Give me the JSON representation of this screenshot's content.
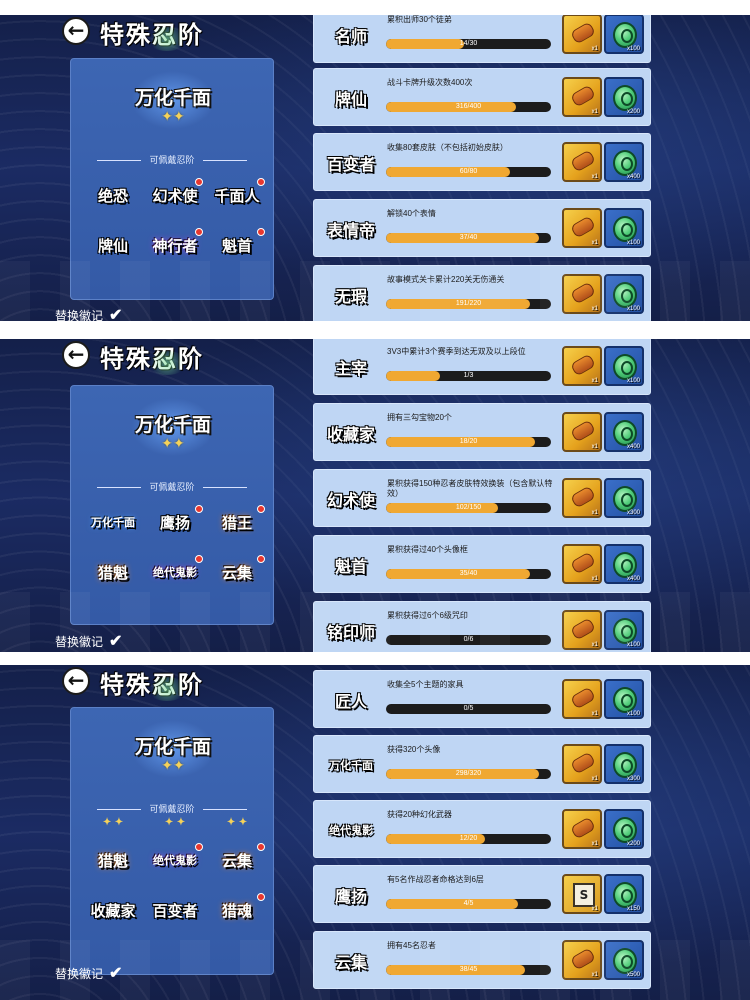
{
  "header": {
    "back_icon": "back-arrow-icon",
    "title": "特殊忍阶"
  },
  "current_title": {
    "text": "万化千面",
    "stars": "✦✦"
  },
  "section_label": "可佩戴忍阶",
  "replace_badge_label": "替换徽记",
  "replace_badge_checked": true,
  "reward_icons": {
    "scroll": "scroll-icon",
    "token": "green-token-icon",
    "card": "card-pack-icon"
  },
  "colors": {
    "panel": "#3d66b3",
    "row": "#bfd6f4",
    "progress_fill": "#f0a832",
    "progress_track": "#1c1c1c",
    "red_dot": "#e8382f"
  },
  "screens": [
    {
      "badges": [
        {
          "label": "绝恐",
          "dot": false,
          "tint": ""
        },
        {
          "label": "幻术使",
          "dot": true,
          "tint": ""
        },
        {
          "label": "千面人",
          "dot": true,
          "tint": ""
        },
        {
          "label": "牌仙",
          "dot": false,
          "tint": ""
        },
        {
          "label": "神行者",
          "dot": true,
          "tint": "purple"
        },
        {
          "label": "魁首",
          "dot": true,
          "tint": ""
        }
      ],
      "tasks": [
        {
          "badge": "名师",
          "desc": "累积出师30个徒弟",
          "progress": "14/30",
          "ratio": 0.47,
          "reward1_qty": "x1",
          "reward2_qty": "x100",
          "reward1": "scroll"
        },
        {
          "badge": "牌仙",
          "desc": "战斗卡牌升级次数400次",
          "progress": "316/400",
          "ratio": 0.79,
          "reward1_qty": "x1",
          "reward2_qty": "x200",
          "reward1": "scroll"
        },
        {
          "badge": "百变者",
          "desc": "收集80套皮肤（不包括初始皮肤）",
          "progress": "60/80",
          "ratio": 0.75,
          "reward1_qty": "x1",
          "reward2_qty": "x400",
          "reward1": "scroll"
        },
        {
          "badge": "表情帝",
          "desc": "解锁40个表情",
          "progress": "37/40",
          "ratio": 0.925,
          "reward1_qty": "x1",
          "reward2_qty": "x100",
          "reward1": "scroll"
        },
        {
          "badge": "无瑕",
          "desc": "故事模式关卡累计220关无伤通关",
          "progress": "191/220",
          "ratio": 0.87,
          "reward1_qty": "x1",
          "reward2_qty": "x100",
          "reward1": "scroll"
        }
      ]
    },
    {
      "badges": [
        {
          "label": "万化千面",
          "dot": false,
          "tint": "blue",
          "small": true
        },
        {
          "label": "鹰扬",
          "dot": true,
          "tint": ""
        },
        {
          "label": "猎王",
          "dot": true,
          "tint": "orange"
        },
        {
          "label": "猎魁",
          "dot": false,
          "tint": "orange"
        },
        {
          "label": "绝代鬼影",
          "dot": true,
          "tint": "purple",
          "small": true
        },
        {
          "label": "云集",
          "dot": true,
          "tint": "orange"
        }
      ],
      "tasks": [
        {
          "badge": "主宰",
          "desc": "3V3中累计3个赛季到达无双及以上段位",
          "progress": "1/3",
          "ratio": 0.33,
          "reward1_qty": "x1",
          "reward2_qty": "x100",
          "reward1": "scroll"
        },
        {
          "badge": "收藏家",
          "desc": "拥有三勾宝物20个",
          "progress": "18/20",
          "ratio": 0.9,
          "reward1_qty": "x1",
          "reward2_qty": "x400",
          "reward1": "scroll"
        },
        {
          "badge": "幻术使",
          "desc": "累积获得150种忍者皮肤特效换装（包含默认特效）",
          "progress": "102/150",
          "ratio": 0.68,
          "reward1_qty": "x1",
          "reward2_qty": "x300",
          "reward1": "scroll"
        },
        {
          "badge": "魁首",
          "desc": "累积获得过40个头像框",
          "progress": "35/40",
          "ratio": 0.875,
          "reward1_qty": "x1",
          "reward2_qty": "x400",
          "reward1": "scroll"
        },
        {
          "badge": "铭印师",
          "desc": "累积获得过6个6级咒印",
          "progress": "0/6",
          "ratio": 0.0,
          "reward1_qty": "x1",
          "reward2_qty": "x100",
          "reward1": "scroll"
        }
      ]
    },
    {
      "badges": [
        {
          "label": "✦ ✦",
          "dot": false,
          "tint": "",
          "stub": true
        },
        {
          "label": "✦ ✦",
          "dot": false,
          "tint": "",
          "stub": true
        },
        {
          "label": "✦ ✦",
          "dot": false,
          "tint": "",
          "stub": true
        },
        {
          "label": "猎魁",
          "dot": false,
          "tint": "orange"
        },
        {
          "label": "绝代鬼影",
          "dot": true,
          "tint": "purple",
          "small": true
        },
        {
          "label": "云集",
          "dot": true,
          "tint": "orange"
        },
        {
          "label": "收藏家",
          "dot": false,
          "tint": ""
        },
        {
          "label": "百变者",
          "dot": false,
          "tint": ""
        },
        {
          "label": "猎魂",
          "dot": true,
          "tint": "orange"
        }
      ],
      "tasks": [
        {
          "badge": "匠人",
          "desc": "收集全5个主题的家具",
          "progress": "0/5",
          "ratio": 0.0,
          "reward1_qty": "x1",
          "reward2_qty": "x100",
          "reward1": "scroll"
        },
        {
          "badge": "万化千面",
          "desc": "获得320个头像",
          "progress": "298/320",
          "ratio": 0.93,
          "reward1_qty": "x1",
          "reward2_qty": "x300",
          "reward1": "scroll",
          "small": true
        },
        {
          "badge": "绝代鬼影",
          "desc": "获得20种幻化武器",
          "progress": "12/20",
          "ratio": 0.6,
          "reward1_qty": "x1",
          "reward2_qty": "x200",
          "reward1": "scroll",
          "small": true
        },
        {
          "badge": "鹰扬",
          "desc": "有5名作战忍者命格达到6层",
          "progress": "4/5",
          "ratio": 0.8,
          "reward1_qty": "x1",
          "reward2_qty": "x150",
          "reward1": "card"
        },
        {
          "badge": "云集",
          "desc": "拥有45名忍者",
          "progress": "38/45",
          "ratio": 0.84,
          "reward1_qty": "x1",
          "reward2_qty": "x500",
          "reward1": "scroll"
        }
      ]
    }
  ]
}
